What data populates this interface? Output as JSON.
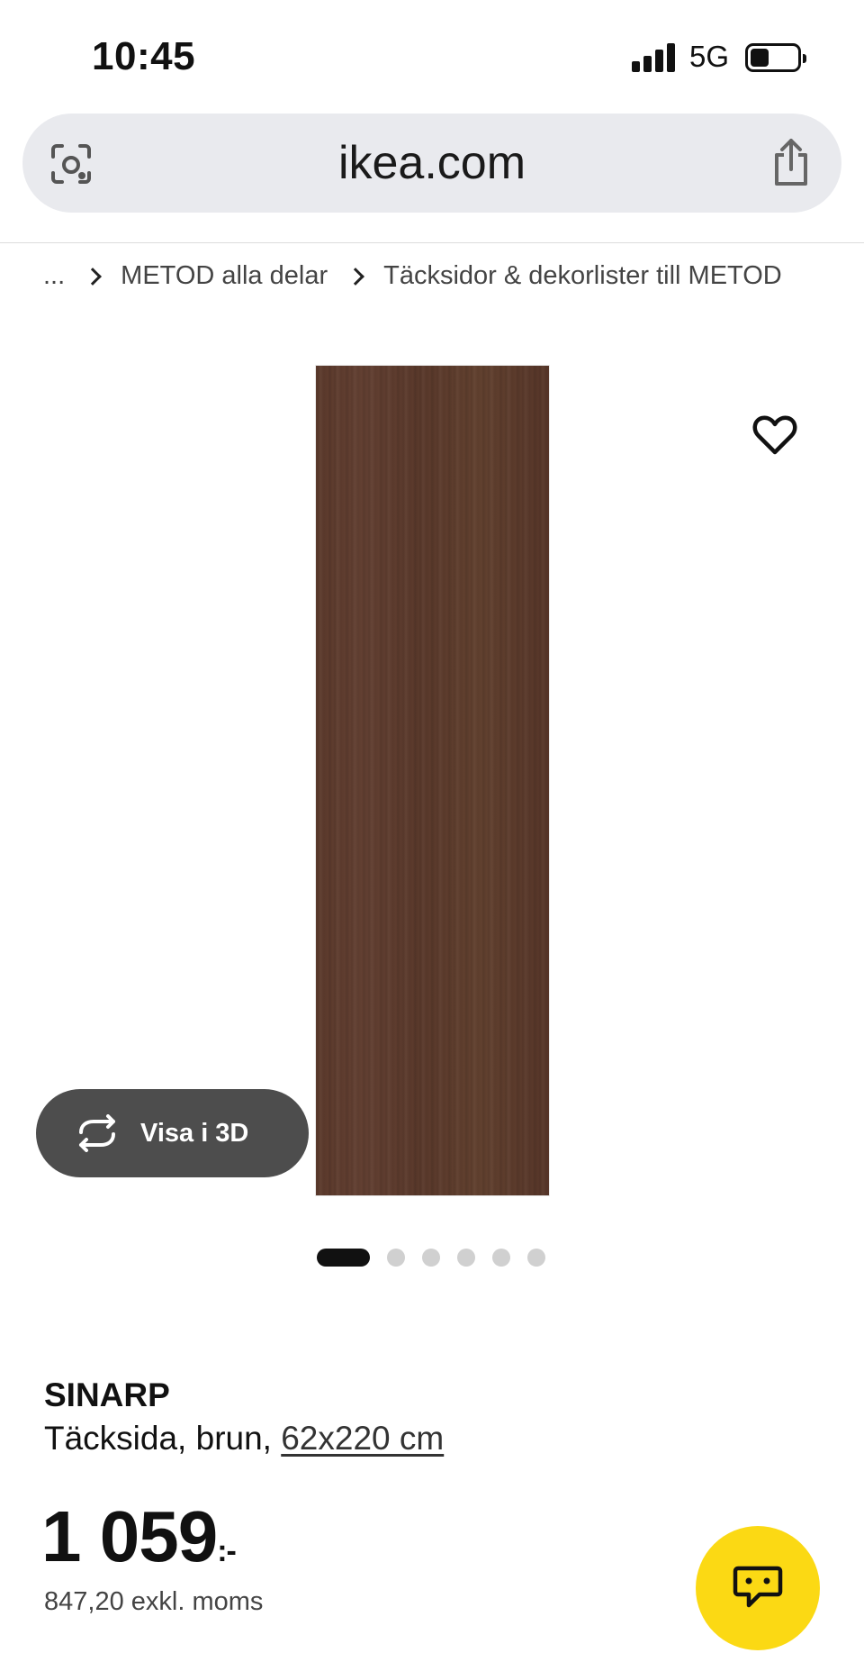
{
  "status_bar": {
    "time": "10:45",
    "network": "5G",
    "signal_bars": 4,
    "battery_level": 0.35
  },
  "browser": {
    "url": "ikea.com",
    "left_icon": "lens-icon",
    "right_icon": "share-icon"
  },
  "breadcrumb": {
    "items": [
      "...",
      "METOD alla delar",
      "Täcksidor & dekorlister till METOD"
    ]
  },
  "gallery": {
    "favorite_icon": "heart-icon",
    "view_3d_label": "Visa i 3D",
    "view_3d_icon": "rotate-icon",
    "dot_count": 6,
    "active_dot": 1,
    "panel_color": "#5c3a2c"
  },
  "product": {
    "name": "SINARP",
    "description": "Täcksida, brun, ",
    "size": "62x220 cm",
    "price": "1 059",
    "price_suffix": ":-",
    "price_excl": "847,20 exkl. moms"
  },
  "chat": {
    "icon": "chat-icon",
    "color": "#fbd914"
  }
}
